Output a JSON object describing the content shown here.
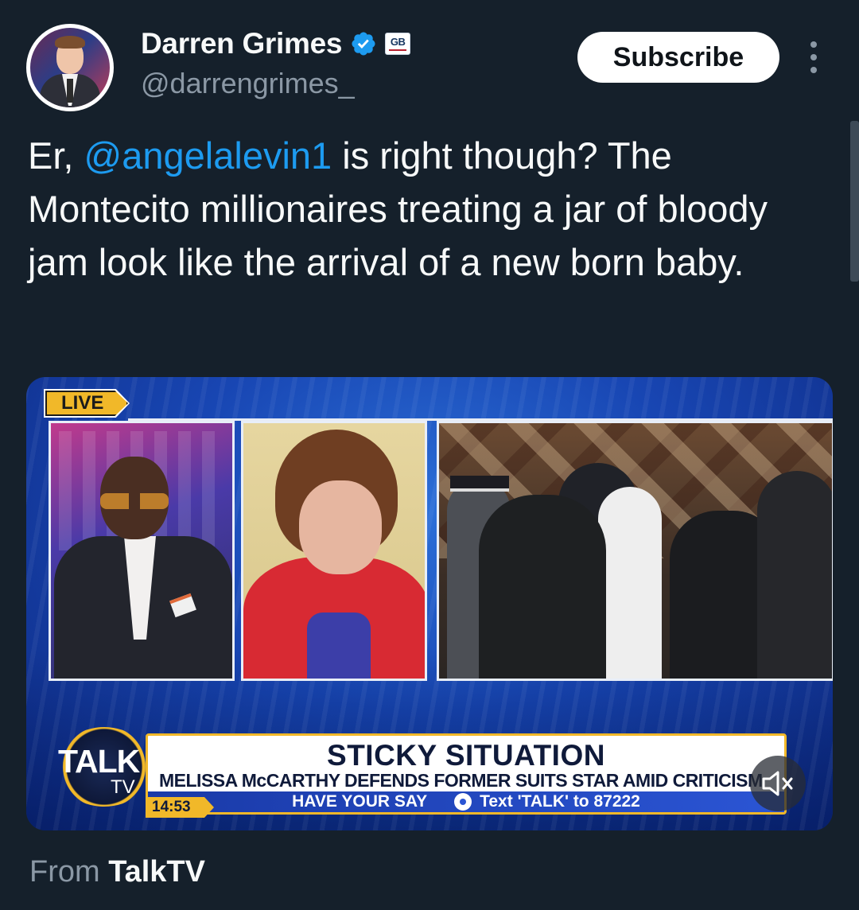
{
  "author": {
    "name": "Darren Grimes",
    "handle": "@darrengrimes_",
    "affiliation_badge": "GB",
    "verified_color": "#1d9bf0"
  },
  "actions": {
    "subscribe_label": "Subscribe"
  },
  "tweet": {
    "text_prefix": "Er, ",
    "mention": "@angelalevin1",
    "text_suffix": " is right though? The Montecito millionaires treating a jar of bloody jam look like the arrival of a new born baby."
  },
  "video": {
    "live_label": "LIVE",
    "channel_logo_main": "TALK",
    "channel_logo_sub": "TV",
    "time": "14:53",
    "headline": "STICKY SITUATION",
    "subheadline": "MELISSA McCARTHY DEFENDS FORMER SUITS STAR AMID CRITICISM",
    "ticker_left": "HAVE YOUR SAY",
    "ticker_right": "Text 'TALK' to 87222",
    "muted": true
  },
  "source": {
    "prefix": "From",
    "name": "TalkTV"
  },
  "colors": {
    "background": "#15202b",
    "accent": "#1d9bf0",
    "secondary_text": "#8b98a5",
    "talk_gold": "#f1b829"
  }
}
